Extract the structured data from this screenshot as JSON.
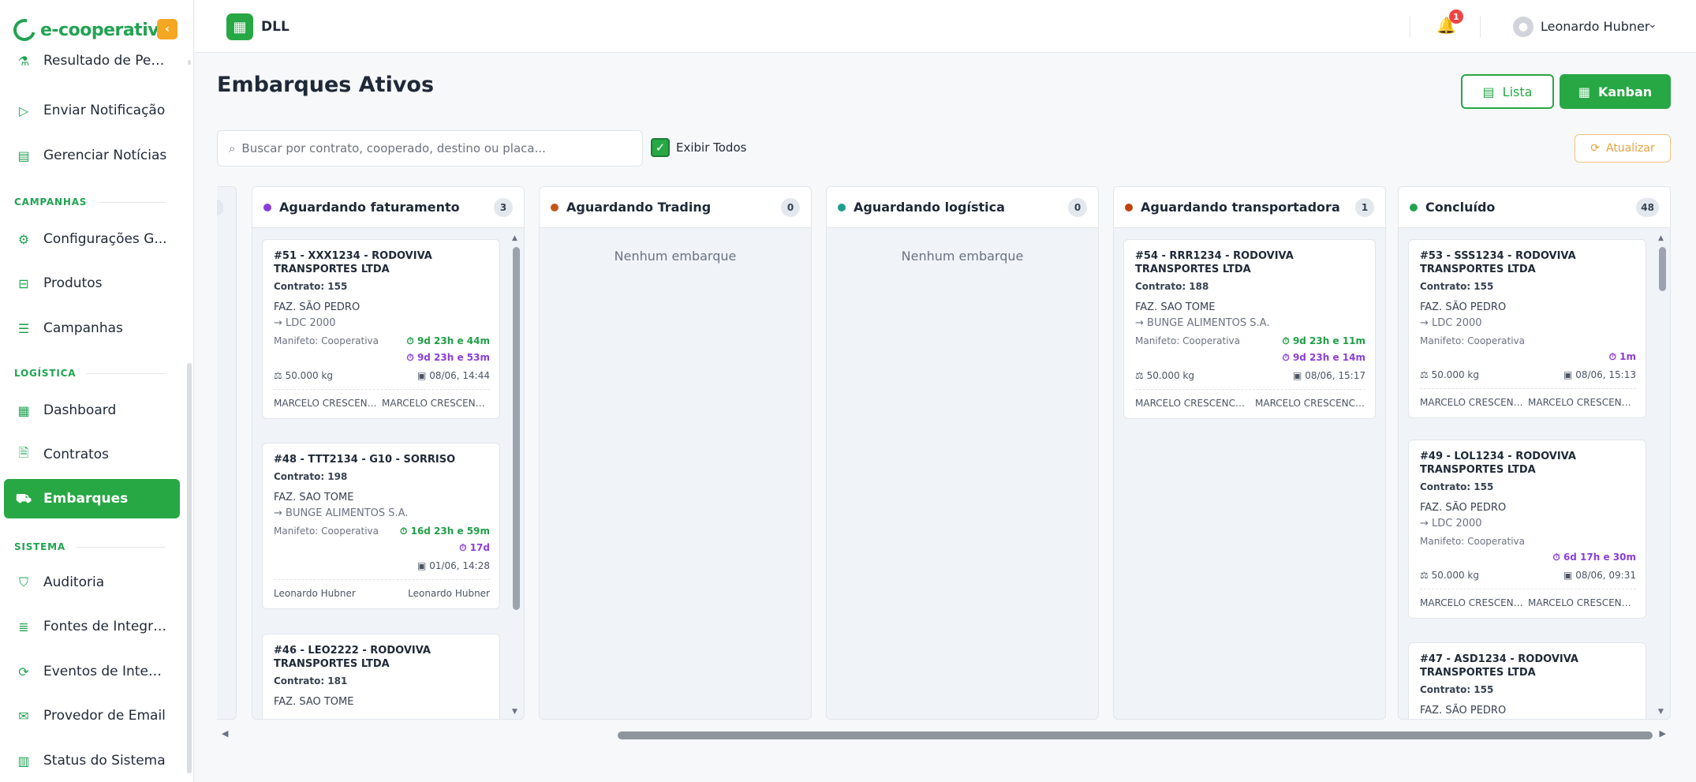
{
  "brand": {
    "name": "e-cooperativa",
    "collapse_icon": "chevron-left-icon"
  },
  "sidebar": {
    "items_top": [
      {
        "label": "Resultado de Pes...",
        "icon": "flask-icon"
      },
      {
        "label": "Enviar Notificação",
        "icon": "send-icon"
      },
      {
        "label": "Gerenciar Notícias",
        "icon": "newspaper-icon"
      }
    ],
    "sections": {
      "campanhas": "CAMPANHAS",
      "logistica": "LOGÍSTICA",
      "sistema": "SISTEMA"
    },
    "campanhas_items": [
      {
        "label": "Configurações G...",
        "icon": "gear-icon"
      },
      {
        "label": "Produtos",
        "icon": "box-icon"
      },
      {
        "label": "Campanhas",
        "icon": "list-icon"
      }
    ],
    "logistica_items": [
      {
        "label": "Dashboard",
        "icon": "dashboard-icon"
      },
      {
        "label": "Contratos",
        "icon": "document-icon"
      },
      {
        "label": "Embarques",
        "icon": "truck-icon",
        "active": true
      }
    ],
    "sistema_items": [
      {
        "label": "Auditoria",
        "icon": "shield-icon"
      },
      {
        "label": "Fontes de Integra...",
        "icon": "database-icon"
      },
      {
        "label": "Eventos de Integr...",
        "icon": "refresh-icon"
      },
      {
        "label": "Provedor de Email",
        "icon": "mail-icon"
      },
      {
        "label": "Status do Sistema",
        "icon": "chart-icon"
      }
    ]
  },
  "topbar": {
    "tenant": "DLL",
    "notifications_count": "1",
    "user_name": "Leonardo Hubner"
  },
  "main": {
    "title": "Embarques Ativos",
    "view_buttons": {
      "lista": "Lista",
      "kanban": "Kanban"
    },
    "search_placeholder": "Buscar por contrato, cooperado, destino ou placa...",
    "show_all_label": "Exibir Todos",
    "show_all_checked": true,
    "refresh_label": "Atualizar"
  },
  "board": {
    "columns": [
      {
        "title": "Aguardando faturamento",
        "count": "3",
        "dot_color": "#8b3fd9",
        "cards": [
          {
            "title": "#51 - XXX1234 - RODOVIVA TRANSPORTES LTDA",
            "contract": "Contrato: 155",
            "farm": "FAZ. SÃO PEDRO",
            "dest": "→ LDC 2000",
            "manifest": "Manifeto: Cooperativa",
            "timer_green": "9d 23h e 44m",
            "timer_purple": "9d 23h e 53m",
            "weight": "50.000 kg",
            "date": "08/06, 14:44",
            "foot_left": "MARCELO CRESCENCI...",
            "foot_right": "MARCELO CRESCENCI..."
          },
          {
            "title": "#48 - TTT2134 - G10 - SORRISO",
            "contract": "Contrato: 198",
            "farm": "FAZ. SAO TOME",
            "dest": "→ BUNGE ALIMENTOS S.A.",
            "manifest": "Manifeto: Cooperativa",
            "timer_green": "16d 23h e 59m",
            "timer_purple": "17d",
            "weight": "",
            "date": "01/06, 14:28",
            "foot_left": "Leonardo Hubner",
            "foot_right": "Leonardo Hubner"
          },
          {
            "title": "#46 - LEO2222 - RODOVIVA TRANSPORTES LTDA",
            "contract": "Contrato: 181",
            "farm": "FAZ. SAO TOME"
          }
        ]
      },
      {
        "title": "Aguardando Trading",
        "count": "0",
        "dot_color": "#c2571a",
        "empty": "Nenhum embarque"
      },
      {
        "title": "Aguardando logística",
        "count": "0",
        "dot_color": "#1e9e8c",
        "empty": "Nenhum embarque"
      },
      {
        "title": "Aguardando transportadora",
        "count": "1",
        "dot_color": "#c2410c",
        "cards": [
          {
            "title": "#54 - RRR1234 - RODOVIVA TRANSPORTES LTDA",
            "contract": "Contrato: 188",
            "farm": "FAZ. SAO TOME",
            "dest": "→ BUNGE ALIMENTOS S.A.",
            "manifest": "Manifeto: Cooperativa",
            "timer_green": "9d 23h e 11m",
            "timer_purple": "9d 23h e 14m",
            "weight": "50.000 kg",
            "date": "08/06, 15:17",
            "foot_left": "MARCELO CRESCENCIO...",
            "foot_right": "MARCELO CRESCENCIO..."
          }
        ]
      },
      {
        "title": "Concluído",
        "count": "48",
        "dot_color": "#22a352",
        "cards": [
          {
            "title": "#53 - SSS1234 - RODOVIVA TRANSPORTES LTDA",
            "contract": "Contrato: 155",
            "farm": "FAZ. SÃO PEDRO",
            "dest": "→ LDC 2000",
            "manifest": "Manifeto: Cooperativa",
            "timer_purple": "1m",
            "weight": "50.000 kg",
            "date": "08/06, 15:13",
            "foot_left": "MARCELO CRESCENCI...",
            "foot_right": "MARCELO CRESCENCI..."
          },
          {
            "title": "#49 - LOL1234 - RODOVIVA TRANSPORTES LTDA",
            "contract": "Contrato: 155",
            "farm": "FAZ. SÃO PEDRO",
            "dest": "→ LDC 2000",
            "manifest": "Manifeto: Cooperativa",
            "timer_purple": "6d 17h e 30m",
            "weight": "50.000 kg",
            "date": "08/06, 09:31",
            "foot_left": "MARCELO CRESCENCI...",
            "foot_right": "MARCELO CRESCENCI..."
          },
          {
            "title": "#47 - ASD1234 - RODOVIVA TRANSPORTES LTDA",
            "contract": "Contrato: 155",
            "farm": "FAZ. SÃO PEDRO"
          }
        ]
      }
    ]
  },
  "colors": {
    "accent": "#28a745",
    "warning": "#f5a623",
    "timer_green": "#1f9e47",
    "timer_purple": "#8b3fd9"
  }
}
